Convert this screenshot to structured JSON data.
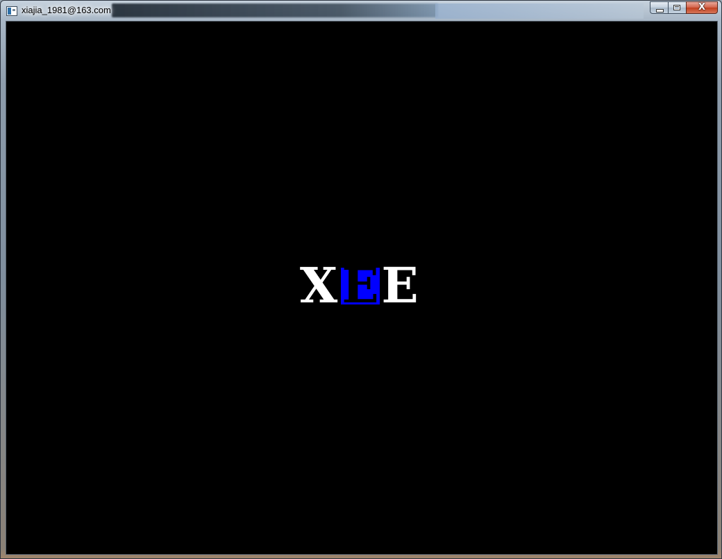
{
  "window": {
    "title": "xiajia_1981@163.com",
    "buttons": {
      "minimize": "minimize",
      "maximize": "maximize",
      "close": "X"
    }
  },
  "canvas": {
    "background": "#000000",
    "logo": {
      "letters": [
        "X",
        "E",
        "E"
      ],
      "colors": [
        "#ffffff",
        "#0000ff",
        "#ffffff"
      ]
    }
  }
}
